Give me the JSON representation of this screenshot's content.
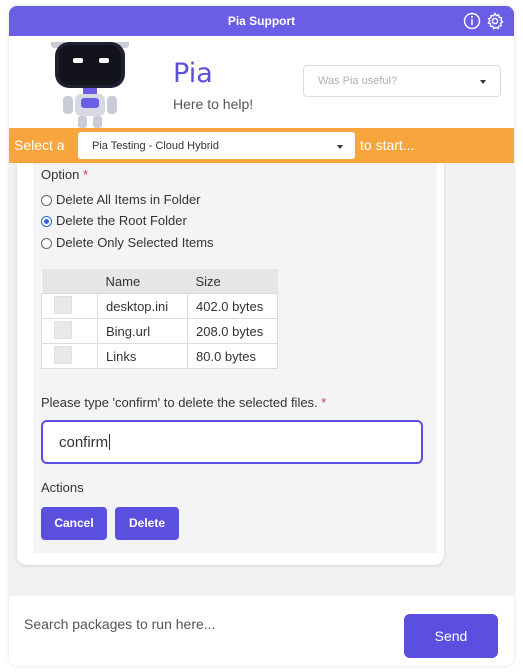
{
  "titlebar": {
    "title": "Pia Support",
    "info_icon": "info-circle-icon",
    "settings_icon": "gear-icon"
  },
  "header": {
    "name": "Pia",
    "subtitle": "Here to help!",
    "useful_placeholder": "Was Pia useful?"
  },
  "selector": {
    "prefix": "Select a",
    "value": "Pia Testing - Cloud Hybrid",
    "suffix": "to start..."
  },
  "form": {
    "option_label": "Option",
    "required_mark": "*",
    "options": [
      {
        "label": "Delete All Items in Folder",
        "checked": false
      },
      {
        "label": "Delete the Root Folder",
        "checked": true
      },
      {
        "label": "Delete Only Selected Items",
        "checked": false
      }
    ],
    "table": {
      "headers": [
        "Name",
        "Size"
      ],
      "rows": [
        {
          "name": "desktop.ini",
          "size": "402.0 bytes"
        },
        {
          "name": "Bing.url",
          "size": "208.0 bytes"
        },
        {
          "name": "Links",
          "size": "80.0 bytes"
        }
      ]
    },
    "confirm_label": "Please type 'confirm' to delete the selected files.",
    "confirm_value": "confirm",
    "actions_label": "Actions",
    "cancel_label": "Cancel",
    "delete_label": "Delete"
  },
  "bottom": {
    "search_placeholder": "Search packages to run here...",
    "send_label": "Send"
  },
  "colors": {
    "accent": "#5b4fe0",
    "orange": "#f7a53c",
    "required": "#e0393e"
  }
}
